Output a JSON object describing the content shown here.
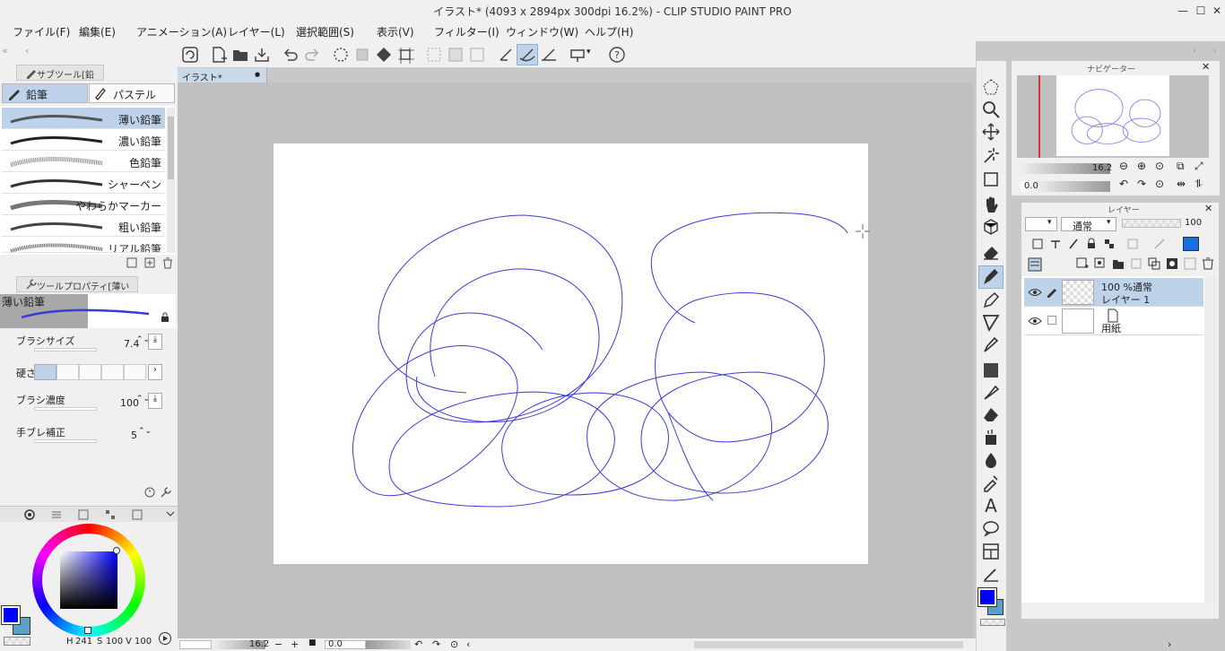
{
  "window": {
    "title": "イラスト* (4093 x 2894px 300dpi 16.2%) - CLIP STUDIO PAINT PRO",
    "minimize": "—",
    "maximize": "☐",
    "close": "✕"
  },
  "menu": [
    "ファイル(F)",
    "編集(E)",
    "アニメーション(A)",
    "レイヤー(L)",
    "選択範囲(S)",
    "表示(V)",
    "フィルター(I)",
    "ウィンドウ(W)",
    "ヘルプ(H)"
  ],
  "subtool": {
    "panel_title": "サブツール[鉛筆]",
    "tabs": [
      "鉛筆",
      "パステル"
    ],
    "brushes": [
      "薄い鉛筆",
      "濃い鉛筆",
      "色鉛筆",
      "シャーペン",
      "やわらかマーカー",
      "粗い鉛筆",
      "リアル鉛筆"
    ]
  },
  "toolprops": {
    "panel_title": "ツールプロパティ[薄い鉛筆]",
    "preview_label": "薄い鉛筆",
    "brush_size_label": "ブラシサイズ",
    "brush_size_value": "7.4",
    "hardness_label": "硬さ",
    "density_label": "ブラシ濃度",
    "density_value": "100",
    "stabilization_label": "手ブレ補正",
    "stabilization_value": "5"
  },
  "color": {
    "main": "#0000ff",
    "sub": "#5aa0c8",
    "readout_h": "241",
    "readout_s": "100",
    "readout_v": "100"
  },
  "document": {
    "tab_label": "イラスト*",
    "tab_dot": "●",
    "stroke_color": "#3a3adc"
  },
  "status": {
    "zoom": "16.2",
    "angle": "0.0"
  },
  "navigator": {
    "title": "ナビゲーター",
    "zoom": "16.2",
    "angle": "0.0"
  },
  "layers": {
    "title": "レイヤー",
    "blend_mode": "通常",
    "opacity": "100",
    "items": [
      {
        "line1": "100 %通常",
        "line2": "レイヤー 1"
      },
      {
        "line1": "",
        "line2": "用紙"
      }
    ]
  }
}
